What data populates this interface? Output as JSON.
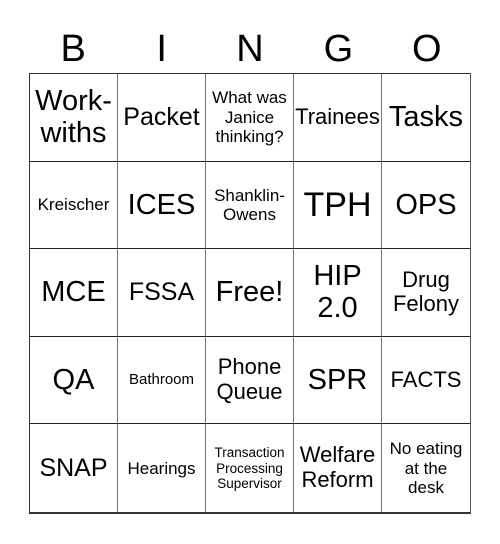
{
  "header": [
    "B",
    "I",
    "N",
    "G",
    "O"
  ],
  "cells": [
    "Work-\nwiths",
    "Packet",
    "What was Janice thinking?",
    "Trainees",
    "Tasks",
    "Kreischer",
    "ICES",
    "Shanklin-\nOwens",
    "TPH",
    "OPS",
    "MCE",
    "FSSA",
    "Free!",
    "HIP\n2.0",
    "Drug\nFelony",
    "QA",
    "Bathroom",
    "Phone\nQueue",
    "SPR",
    "FACTS",
    "SNAP",
    "Hearings",
    "Transaction Processing Supervisor",
    "Welfare\nReform",
    "No eating at the desk"
  ]
}
